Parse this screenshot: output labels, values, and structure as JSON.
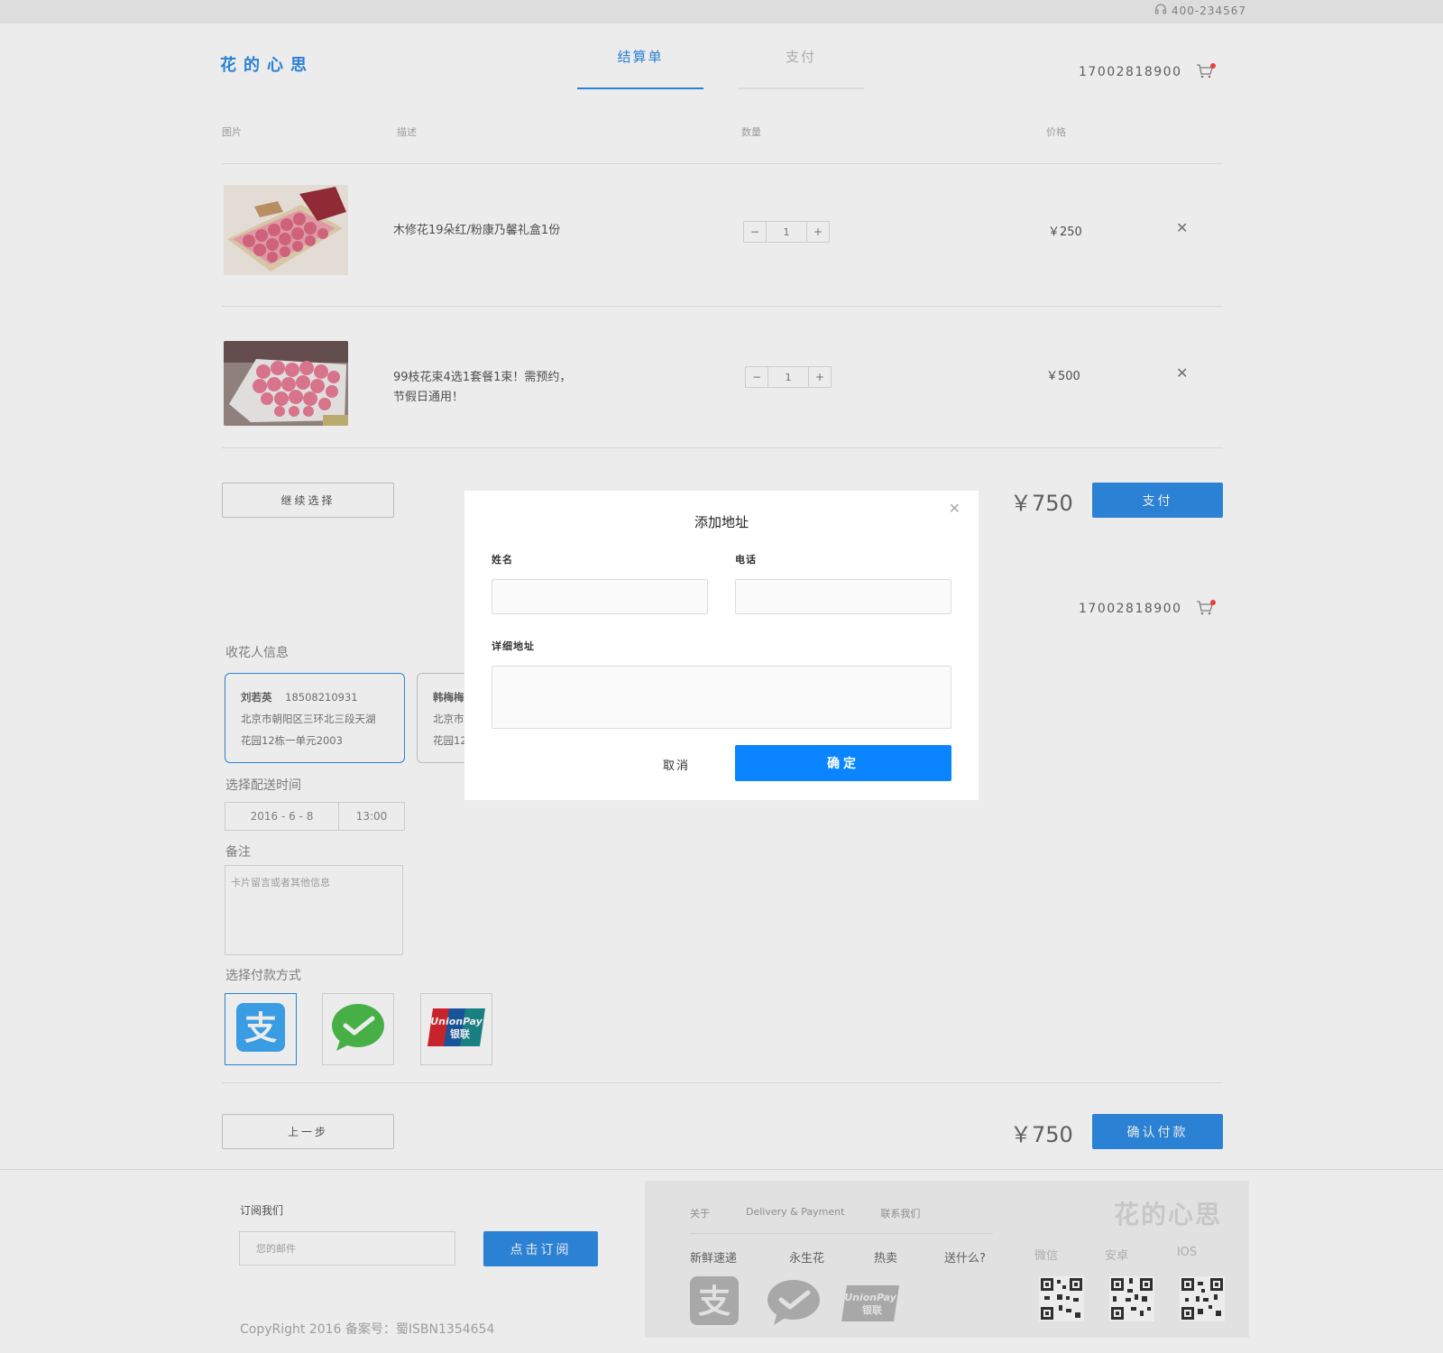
{
  "header": {
    "hotline": "400-234567",
    "logo": "花的心思",
    "steps": [
      "结算单",
      "支付"
    ],
    "user_phone": "17002818900"
  },
  "cart_table": {
    "columns": [
      "图片",
      "描述",
      "数量",
      "价格"
    ],
    "items": [
      {
        "name": "木修花19朵红/粉康乃馨礼盒1份",
        "quantity": "1",
        "price": "￥250"
      },
      {
        "name": "99枝花束4选1套餐1束！需预约，节假日通用！",
        "name_line1": "99枝花束4选1套餐1束！需预约，",
        "name_line2": "节假日通用！",
        "quantity": "1",
        "price": "￥500"
      }
    ],
    "continue_label": "继续选择",
    "total": "￥750",
    "pay_label": "支付"
  },
  "checkout": {
    "user_phone": "17002818900",
    "recipient_label": "收花人信息",
    "addresses": [
      {
        "name": "刘若英",
        "phone": "18508210931",
        "line1": "北京市朝阳区三环北三段天湖",
        "line2": "花园12栋一单元2003"
      },
      {
        "name": "韩梅梅",
        "phone": "",
        "line1": "北京市",
        "line2": "花园12"
      }
    ],
    "delivery_label": "选择配送时间",
    "delivery_date": "2016 - 6 - 8",
    "delivery_time": "13:00",
    "note_label": "备注",
    "note_placeholder": "卡片留言或者其他信息",
    "payment_label": "选择付款方式",
    "payment_methods": [
      "alipay-icon",
      "wechat-pay-icon",
      "unionpay-icon"
    ],
    "prev_label": "上一步",
    "total": "￥750",
    "confirm_label": "确认付款"
  },
  "footer": {
    "subscribe_title": "订阅我们",
    "email_placeholder": "您的邮件",
    "subscribe_button": "点击订阅",
    "copyright": "CopyRight 2016 备案号：蜀ISBN1354654",
    "links": [
      "关于",
      "Delivery & Payment",
      "联系我们"
    ],
    "categories": [
      "新鲜速递",
      "永生花",
      "热卖",
      "送什么?"
    ],
    "logo": "花的心思",
    "qr_labels": [
      "微信",
      "安卓",
      "IOS"
    ]
  },
  "modal": {
    "title": "添加地址",
    "name_label": "姓名",
    "phone_label": "电话",
    "address_label": "详细地址",
    "cancel_label": "取消",
    "ok_label": "确定"
  },
  "colors": {
    "accent": "#2f8ce6",
    "modal_button": "#0a84ff",
    "badge": "#ff4444"
  }
}
